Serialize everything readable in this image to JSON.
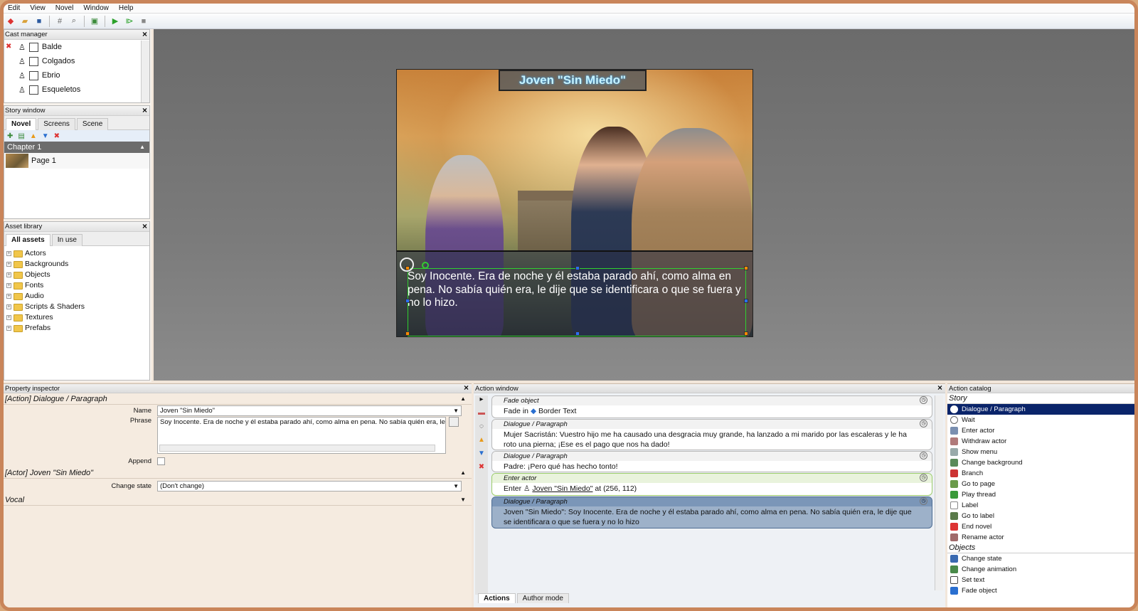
{
  "menu": [
    "Edit",
    "View",
    "Novel",
    "Window",
    "Help"
  ],
  "cast_manager": {
    "title": "Cast manager",
    "items": [
      "Balde",
      "Colgados",
      "Ebrio",
      "Esqueletos"
    ]
  },
  "story_window": {
    "title": "Story window",
    "tabs": [
      "Novel",
      "Screens",
      "Scene"
    ],
    "chapter": "Chapter 1",
    "page": "Page 1"
  },
  "asset_library": {
    "title": "Asset library",
    "tabs": [
      "All assets",
      "In use"
    ],
    "folders": [
      "Actors",
      "Backgrounds",
      "Objects",
      "Fonts",
      "Audio",
      "Scripts & Shaders",
      "Textures",
      "Prefabs"
    ]
  },
  "scene": {
    "title": "Joven \"Sin Miedo\"",
    "dialogue": "Soy Inocente. Era de noche y él estaba parado ahí, como alma en pena. No sabía quién era, le dije que se identificara o que se fuera y no lo hizo."
  },
  "property_inspector": {
    "title": "Property inspector",
    "section1": "[Action] Dialogue / Paragraph",
    "name_label": "Name",
    "name_value": "Joven \"Sin Miedo\"",
    "phrase_label": "Phrase",
    "phrase_value": "Soy Inocente. Era de noche y él estaba parado ahí, como alma en pena. No sabía quién era, le dije",
    "append_label": "Append",
    "section2": "[Actor] Joven \"Sin Miedo\"",
    "change_state_label": "Change state",
    "change_state_value": "(Don't change)",
    "section3": "Vocal"
  },
  "action_window": {
    "title": "Action window",
    "actions": [
      {
        "type": "Fade object",
        "prefix": "Fade in",
        "text": "Border Text"
      },
      {
        "type": "Dialogue / Paragraph",
        "text": "Mujer Sacristán: Vuestro hijo me ha causado una desgracia muy grande, ha lanzado a mi marido por las escaleras y le ha roto una pierna; ¡Ese es el pago que nos ha dado!"
      },
      {
        "type": "Dialogue / Paragraph",
        "text": "Padre: ¡Pero qué has hecho tonto!"
      },
      {
        "type": "Enter actor",
        "prefix": "Enter",
        "text": "Joven \"Sin Miedo\"",
        "suffix": "at (256, 112)"
      },
      {
        "type": "Dialogue / Paragraph",
        "text": "Joven \"Sin Miedo\": Soy Inocente. Era de noche y él estaba parado ahí, como alma en pena. No sabía quién era, le dije que se identificara o que se fuera y no lo hizo"
      }
    ],
    "bottom_tabs": [
      "Actions",
      "Author mode"
    ]
  },
  "action_catalog": {
    "title": "Action catalog",
    "story_group": "Story",
    "story_items": [
      "Dialogue / Paragraph",
      "Wait",
      "Enter actor",
      "Withdraw actor",
      "Show menu",
      "Change background",
      "Branch",
      "Go to page",
      "Play thread",
      "Label",
      "Go to label",
      "End novel",
      "Rename actor"
    ],
    "objects_group": "Objects",
    "objects_items": [
      "Change state",
      "Change animation",
      "Set text",
      "Fade object"
    ]
  },
  "colors": {
    "accent_frame": "#c9855a",
    "selection": "#0a246a",
    "chapter_bar": "#6c6c6c"
  }
}
